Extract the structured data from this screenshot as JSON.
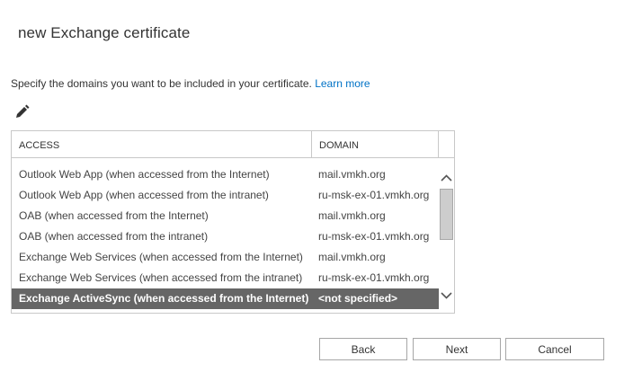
{
  "dialog": {
    "title": "new Exchange certificate",
    "instruction": "Specify the domains you want to be included in your certificate. ",
    "learn_more": "Learn more",
    "edit_icon": "pencil-icon"
  },
  "grid": {
    "columns": [
      "ACCESS",
      "DOMAIN"
    ],
    "rows": [
      {
        "access": "Outlook Web App (when accessed from the Internet)",
        "domain": "mail.vmkh.org"
      },
      {
        "access": "Outlook Web App (when accessed from the intranet)",
        "domain": "ru-msk-ex-01.vmkh.org"
      },
      {
        "access": "OAB (when accessed from the Internet)",
        "domain": "mail.vmkh.org"
      },
      {
        "access": "OAB (when accessed from the intranet)",
        "domain": "ru-msk-ex-01.vmkh.org"
      },
      {
        "access": "Exchange Web Services (when accessed from the Internet)",
        "domain": "mail.vmkh.org"
      },
      {
        "access": "Exchange Web Services (when accessed from the intranet)",
        "domain": "ru-msk-ex-01.vmkh.org"
      },
      {
        "access": "Exchange ActiveSync (when accessed from the Internet)",
        "domain": "<not specified>"
      }
    ],
    "selected_row": 6,
    "scroll_up_icon": "chevron-up-icon",
    "scroll_down_icon": "chevron-down-icon"
  },
  "buttons": {
    "back": "Back",
    "next": "Next",
    "cancel": "Cancel"
  },
  "colors": {
    "link": "#0072c6",
    "selected_row_bg": "#666666",
    "border": "#c8c8c8"
  }
}
